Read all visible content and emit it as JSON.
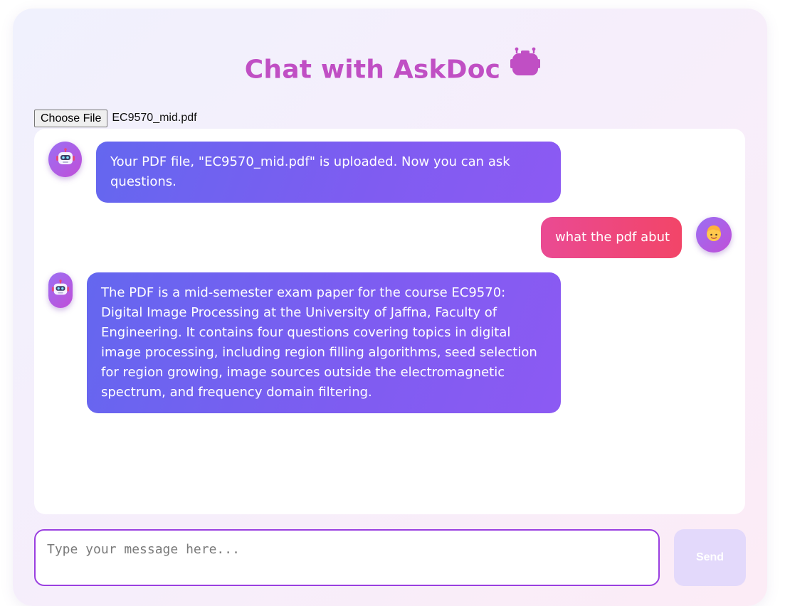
{
  "header": {
    "title": "Chat with AskDoc",
    "title_icon": "robot-icon",
    "title_color": "#c04fc4"
  },
  "upload": {
    "button_label": "Choose File",
    "file_name": "EC9570_mid.pdf"
  },
  "messages": [
    {
      "sender": "bot",
      "avatar_icon": "robot-face-icon",
      "text": "Your PDF file, \"EC9570_mid.pdf\" is uploaded. Now you can ask questions."
    },
    {
      "sender": "user",
      "avatar_icon": "person-face-icon",
      "text": "what the pdf abut"
    },
    {
      "sender": "bot",
      "avatar_icon": "robot-face-icon",
      "text": "The PDF is a mid-semester exam paper for the course EC9570: Digital Image Processing at the University of Jaffna, Faculty of Engineering. It contains four questions covering topics in digital image processing, including region filling algorithms, seed selection for region growing, image sources outside the electromagnetic spectrum, and frequency domain filtering."
    }
  ],
  "composer": {
    "placeholder": "Type your message here...",
    "value": "",
    "send_label": "Send"
  },
  "colors": {
    "bot_bubble": "#6a64f0",
    "user_bubble": "#ee4880",
    "avatar": "#a865ec",
    "input_border": "#9a3fe0",
    "send_disabled": "#e3d9fb"
  }
}
